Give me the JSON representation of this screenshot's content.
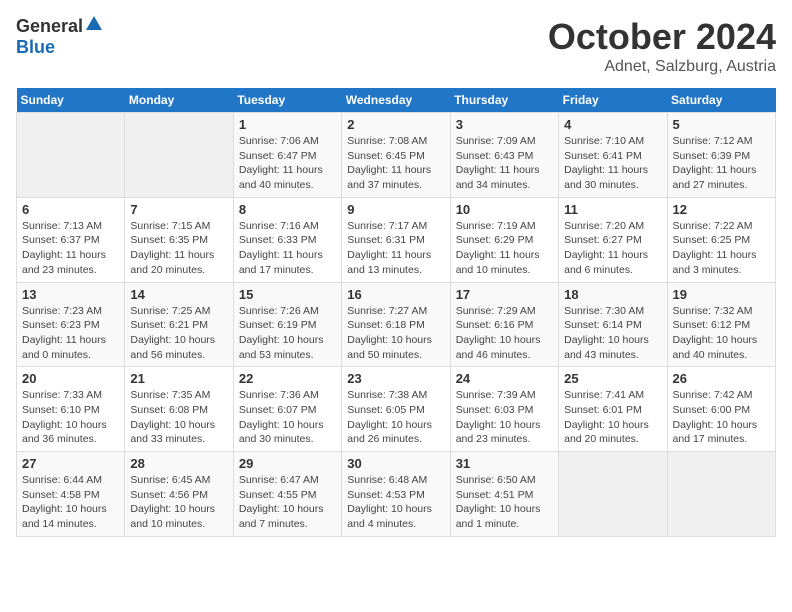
{
  "logo": {
    "general": "General",
    "blue": "Blue"
  },
  "title": "October 2024",
  "subtitle": "Adnet, Salzburg, Austria",
  "days_of_week": [
    "Sunday",
    "Monday",
    "Tuesday",
    "Wednesday",
    "Thursday",
    "Friday",
    "Saturday"
  ],
  "weeks": [
    [
      {
        "day": "",
        "info": ""
      },
      {
        "day": "",
        "info": ""
      },
      {
        "day": "1",
        "info": "Sunrise: 7:06 AM\nSunset: 6:47 PM\nDaylight: 11 hours and 40 minutes."
      },
      {
        "day": "2",
        "info": "Sunrise: 7:08 AM\nSunset: 6:45 PM\nDaylight: 11 hours and 37 minutes."
      },
      {
        "day": "3",
        "info": "Sunrise: 7:09 AM\nSunset: 6:43 PM\nDaylight: 11 hours and 34 minutes."
      },
      {
        "day": "4",
        "info": "Sunrise: 7:10 AM\nSunset: 6:41 PM\nDaylight: 11 hours and 30 minutes."
      },
      {
        "day": "5",
        "info": "Sunrise: 7:12 AM\nSunset: 6:39 PM\nDaylight: 11 hours and 27 minutes."
      }
    ],
    [
      {
        "day": "6",
        "info": "Sunrise: 7:13 AM\nSunset: 6:37 PM\nDaylight: 11 hours and 23 minutes."
      },
      {
        "day": "7",
        "info": "Sunrise: 7:15 AM\nSunset: 6:35 PM\nDaylight: 11 hours and 20 minutes."
      },
      {
        "day": "8",
        "info": "Sunrise: 7:16 AM\nSunset: 6:33 PM\nDaylight: 11 hours and 17 minutes."
      },
      {
        "day": "9",
        "info": "Sunrise: 7:17 AM\nSunset: 6:31 PM\nDaylight: 11 hours and 13 minutes."
      },
      {
        "day": "10",
        "info": "Sunrise: 7:19 AM\nSunset: 6:29 PM\nDaylight: 11 hours and 10 minutes."
      },
      {
        "day": "11",
        "info": "Sunrise: 7:20 AM\nSunset: 6:27 PM\nDaylight: 11 hours and 6 minutes."
      },
      {
        "day": "12",
        "info": "Sunrise: 7:22 AM\nSunset: 6:25 PM\nDaylight: 11 hours and 3 minutes."
      }
    ],
    [
      {
        "day": "13",
        "info": "Sunrise: 7:23 AM\nSunset: 6:23 PM\nDaylight: 11 hours and 0 minutes."
      },
      {
        "day": "14",
        "info": "Sunrise: 7:25 AM\nSunset: 6:21 PM\nDaylight: 10 hours and 56 minutes."
      },
      {
        "day": "15",
        "info": "Sunrise: 7:26 AM\nSunset: 6:19 PM\nDaylight: 10 hours and 53 minutes."
      },
      {
        "day": "16",
        "info": "Sunrise: 7:27 AM\nSunset: 6:18 PM\nDaylight: 10 hours and 50 minutes."
      },
      {
        "day": "17",
        "info": "Sunrise: 7:29 AM\nSunset: 6:16 PM\nDaylight: 10 hours and 46 minutes."
      },
      {
        "day": "18",
        "info": "Sunrise: 7:30 AM\nSunset: 6:14 PM\nDaylight: 10 hours and 43 minutes."
      },
      {
        "day": "19",
        "info": "Sunrise: 7:32 AM\nSunset: 6:12 PM\nDaylight: 10 hours and 40 minutes."
      }
    ],
    [
      {
        "day": "20",
        "info": "Sunrise: 7:33 AM\nSunset: 6:10 PM\nDaylight: 10 hours and 36 minutes."
      },
      {
        "day": "21",
        "info": "Sunrise: 7:35 AM\nSunset: 6:08 PM\nDaylight: 10 hours and 33 minutes."
      },
      {
        "day": "22",
        "info": "Sunrise: 7:36 AM\nSunset: 6:07 PM\nDaylight: 10 hours and 30 minutes."
      },
      {
        "day": "23",
        "info": "Sunrise: 7:38 AM\nSunset: 6:05 PM\nDaylight: 10 hours and 26 minutes."
      },
      {
        "day": "24",
        "info": "Sunrise: 7:39 AM\nSunset: 6:03 PM\nDaylight: 10 hours and 23 minutes."
      },
      {
        "day": "25",
        "info": "Sunrise: 7:41 AM\nSunset: 6:01 PM\nDaylight: 10 hours and 20 minutes."
      },
      {
        "day": "26",
        "info": "Sunrise: 7:42 AM\nSunset: 6:00 PM\nDaylight: 10 hours and 17 minutes."
      }
    ],
    [
      {
        "day": "27",
        "info": "Sunrise: 6:44 AM\nSunset: 4:58 PM\nDaylight: 10 hours and 14 minutes."
      },
      {
        "day": "28",
        "info": "Sunrise: 6:45 AM\nSunset: 4:56 PM\nDaylight: 10 hours and 10 minutes."
      },
      {
        "day": "29",
        "info": "Sunrise: 6:47 AM\nSunset: 4:55 PM\nDaylight: 10 hours and 7 minutes."
      },
      {
        "day": "30",
        "info": "Sunrise: 6:48 AM\nSunset: 4:53 PM\nDaylight: 10 hours and 4 minutes."
      },
      {
        "day": "31",
        "info": "Sunrise: 6:50 AM\nSunset: 4:51 PM\nDaylight: 10 hours and 1 minute."
      },
      {
        "day": "",
        "info": ""
      },
      {
        "day": "",
        "info": ""
      }
    ]
  ]
}
